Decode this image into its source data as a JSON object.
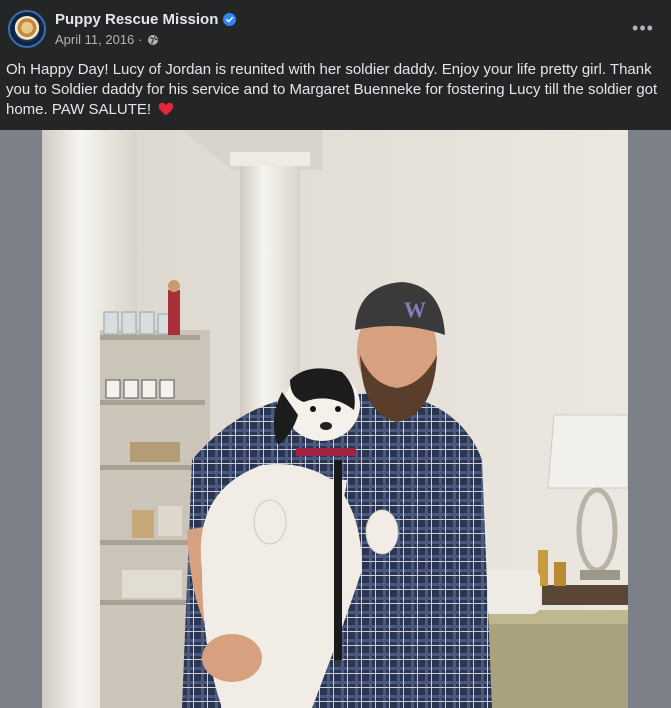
{
  "post": {
    "page_name": "Puppy Rescue Mission",
    "date": "April 11, 2016",
    "separator": "·",
    "more_label": "•••",
    "text": "Oh Happy Day!  Lucy of Jordan is reunited with her soldier daddy. Enjoy your life pretty girl. Thank you to Soldier daddy for his service and to Margaret Buenneke for fostering Lucy till the soldier got home. PAW SALUTE!"
  },
  "photo": {
    "cap_logo": "W"
  },
  "icons": {
    "verified": "verified-badge-icon",
    "privacy": "globe-icon",
    "heart": "red-heart-emoji"
  },
  "colors": {
    "background": "#242526",
    "text_primary": "#e4e6eb",
    "text_secondary": "#b0b3b8",
    "verified_blue": "#2d88ff",
    "heart_red": "#e4253f"
  }
}
